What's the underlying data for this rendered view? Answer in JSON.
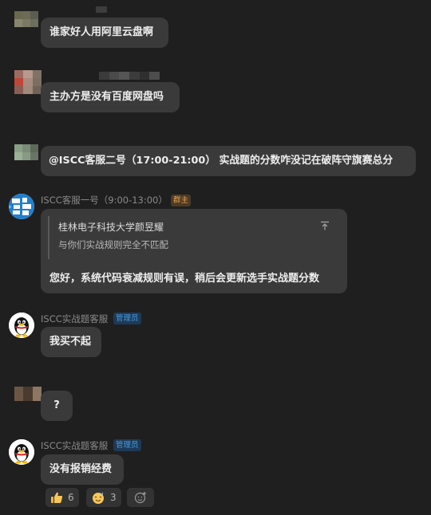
{
  "messages": [
    {
      "id": "m1",
      "text": "谁家好人用阿里云盘啊"
    },
    {
      "id": "m2",
      "text": "主办方是没有百度网盘吗"
    },
    {
      "id": "m3",
      "text": "@ISCC客服二号（17:00-21:00） 实战题的分数咋没记在破阵守旗赛总分"
    },
    {
      "id": "m4",
      "sender": "ISCC客服一号（9:00-13:00）",
      "badge": "群主",
      "quote": {
        "name": "桂林电子科技大学颜昱耀",
        "text": "与你们实战规则完全不匹配"
      },
      "text": "您好，系统代码衰减规则有误，稍后会更新选手实战题分数"
    },
    {
      "id": "m5",
      "sender": "ISCC实战题客服",
      "badge": "管理员",
      "text": "我买不起"
    },
    {
      "id": "m6",
      "text": "?"
    },
    {
      "id": "m7",
      "sender": "ISCC实战题客服",
      "badge": "管理员",
      "text": "没有报销经费",
      "reactions": [
        {
          "icon": "thumbs-up-icon",
          "count": "6"
        },
        {
          "icon": "sweat-smile-icon",
          "count": "3"
        },
        {
          "icon": "add-reaction-icon",
          "count": ""
        }
      ]
    }
  ],
  "colors": {
    "background": "#1f1f1f",
    "bubble": "#3a3a3a",
    "owner_badge": "#e4a255",
    "admin_badge": "#4a9be0"
  }
}
